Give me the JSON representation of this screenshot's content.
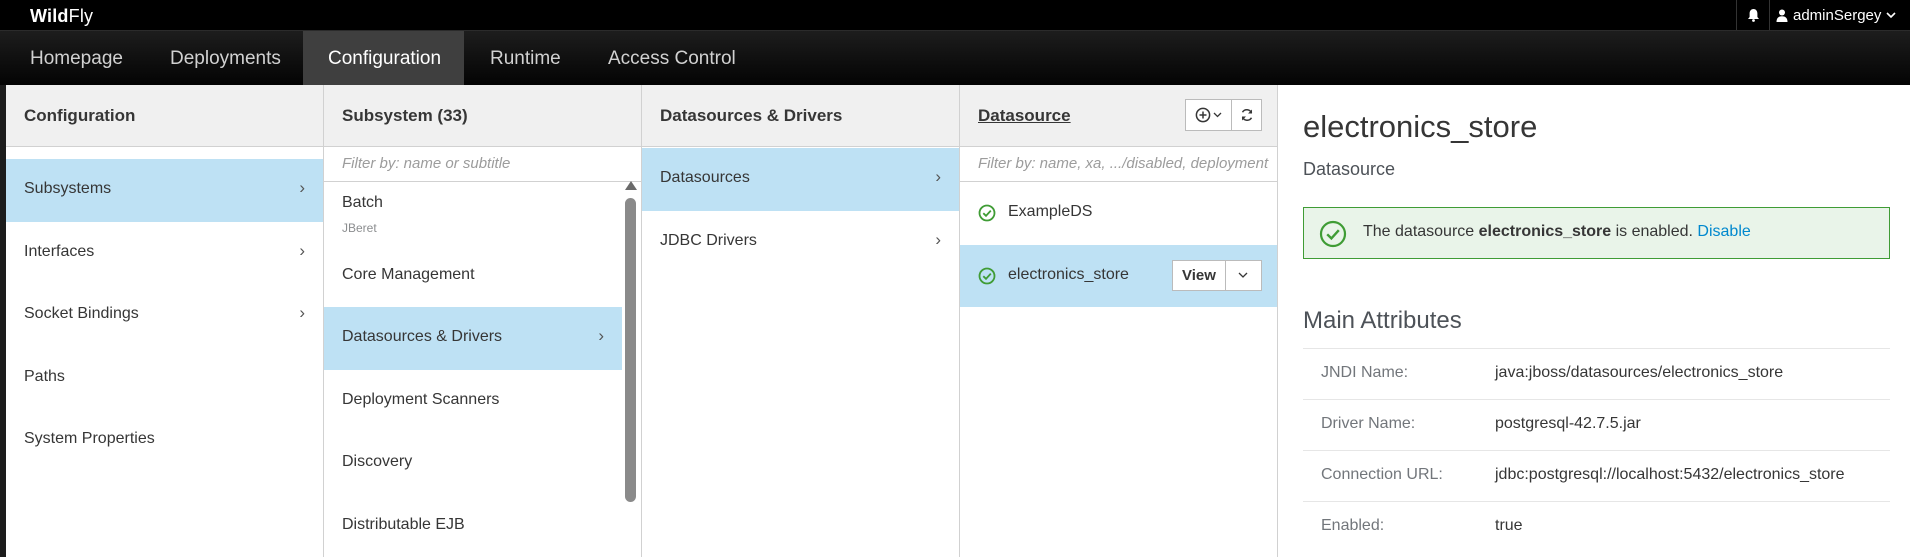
{
  "brand": {
    "part1": "Wild",
    "part2": "Fly"
  },
  "topbar": {
    "username": "adminSergey"
  },
  "nav": {
    "items": [
      {
        "label": "Homepage",
        "active": false
      },
      {
        "label": "Deployments",
        "active": false
      },
      {
        "label": "Configuration",
        "active": true
      },
      {
        "label": "Runtime",
        "active": false
      },
      {
        "label": "Access Control",
        "active": false
      }
    ]
  },
  "config_col": {
    "title": "Configuration",
    "items": [
      {
        "label": "Subsystems",
        "selected": true,
        "chevron": true
      },
      {
        "label": "Interfaces",
        "selected": false,
        "chevron": true
      },
      {
        "label": "Socket Bindings",
        "selected": false,
        "chevron": true
      },
      {
        "label": "Paths",
        "selected": false,
        "chevron": false
      },
      {
        "label": "System Properties",
        "selected": false,
        "chevron": false
      }
    ]
  },
  "subsystem_col": {
    "title": "Subsystem (33)",
    "filter_placeholder": "Filter by: name or subtitle",
    "items": [
      {
        "label": "Batch",
        "subtitle": "JBeret",
        "selected": false,
        "chevron": false
      },
      {
        "label": "Core Management",
        "subtitle": "",
        "selected": false,
        "chevron": false
      },
      {
        "label": "Datasources & Drivers",
        "subtitle": "",
        "selected": true,
        "chevron": true
      },
      {
        "label": "Deployment Scanners",
        "subtitle": "",
        "selected": false,
        "chevron": false
      },
      {
        "label": "Discovery",
        "subtitle": "",
        "selected": false,
        "chevron": false
      },
      {
        "label": "Distributable EJB",
        "subtitle": "",
        "selected": false,
        "chevron": false
      }
    ]
  },
  "dsdrivers_col": {
    "title": "Datasources & Drivers",
    "items": [
      {
        "label": "Datasources",
        "selected": true,
        "chevron": true
      },
      {
        "label": "JDBC Drivers",
        "selected": false,
        "chevron": true
      }
    ]
  },
  "datasource_col": {
    "title": "Datasource",
    "filter_placeholder": "Filter by: name, xa, .../disabled, deployment",
    "items": [
      {
        "label": "ExampleDS",
        "selected": false
      },
      {
        "label": "electronics_store",
        "selected": true
      }
    ],
    "view_label": "View"
  },
  "detail": {
    "title": "electronics_store",
    "subtitle": "Datasource",
    "alert": {
      "prefix": "The datasource ",
      "name": "electronics_store",
      "suffix": " is enabled. ",
      "link": "Disable"
    },
    "section_title": "Main Attributes",
    "attributes": [
      {
        "name": "JNDI Name:",
        "value": "java:jboss/datasources/electronics_store"
      },
      {
        "name": "Driver Name:",
        "value": "postgresql-42.7.5.jar"
      },
      {
        "name": "Connection URL:",
        "value": "jdbc:postgresql://localhost:5432/electronics_store"
      },
      {
        "name": "Enabled:",
        "value": "true"
      }
    ]
  },
  "colors": {
    "selected_bg": "#bee1f4",
    "success_green": "#3f9c35",
    "link_blue": "#0088ce",
    "nav_active_bg": "#3f3f3f"
  }
}
